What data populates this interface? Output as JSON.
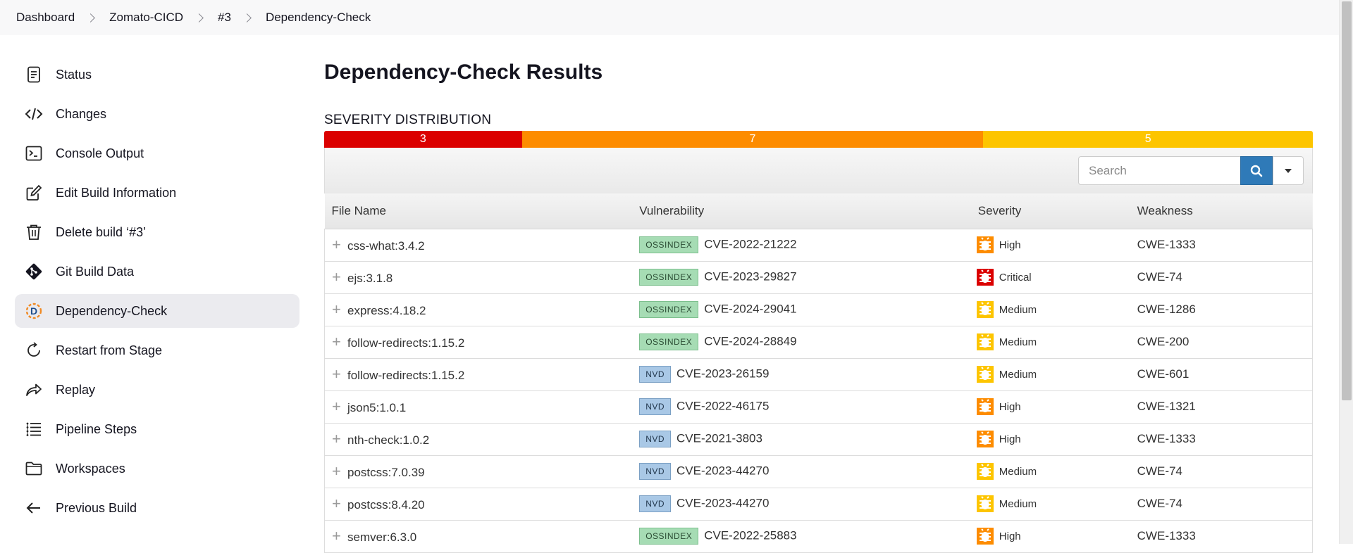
{
  "breadcrumb": [
    "Dashboard",
    "Zomato-CICD",
    "#3",
    "Dependency-Check"
  ],
  "sidebar": {
    "items": [
      {
        "label": "Status",
        "icon": "status-icon"
      },
      {
        "label": "Changes",
        "icon": "code-icon"
      },
      {
        "label": "Console Output",
        "icon": "terminal-icon"
      },
      {
        "label": "Edit Build Information",
        "icon": "edit-icon"
      },
      {
        "label": "Delete build ‘#3’",
        "icon": "trash-icon"
      },
      {
        "label": "Git Build Data",
        "icon": "git-icon"
      },
      {
        "label": "Dependency-Check",
        "icon": "dependency-check-icon",
        "active": true
      },
      {
        "label": "Restart from Stage",
        "icon": "restart-icon"
      },
      {
        "label": "Replay",
        "icon": "replay-icon"
      },
      {
        "label": "Pipeline Steps",
        "icon": "pipeline-steps-icon"
      },
      {
        "label": "Workspaces",
        "icon": "folder-icon"
      },
      {
        "label": "Previous Build",
        "icon": "arrow-left-icon"
      }
    ]
  },
  "main": {
    "title": "Dependency-Check Results",
    "severity_title": "SEVERITY DISTRIBUTION",
    "distribution": [
      {
        "count": "3",
        "color": "#db0000"
      },
      {
        "count": "7",
        "color": "#fd8c00"
      },
      {
        "count": "5",
        "color": "#fdc500"
      }
    ],
    "search": {
      "placeholder": "Search"
    },
    "columns": [
      "File Name",
      "Vulnerability",
      "Severity",
      "Weakness"
    ],
    "rows": [
      {
        "file": "css-what:3.4.2",
        "source": "OSSINDEX",
        "cve": "CVE-2022-21222",
        "severity": "High",
        "weakness": "CWE-1333"
      },
      {
        "file": "ejs:3.1.8",
        "source": "OSSINDEX",
        "cve": "CVE-2023-29827",
        "severity": "Critical",
        "weakness": "CWE-74"
      },
      {
        "file": "express:4.18.2",
        "source": "OSSINDEX",
        "cve": "CVE-2024-29041",
        "severity": "Medium",
        "weakness": "CWE-1286"
      },
      {
        "file": "follow-redirects:1.15.2",
        "source": "OSSINDEX",
        "cve": "CVE-2024-28849",
        "severity": "Medium",
        "weakness": "CWE-200"
      },
      {
        "file": "follow-redirects:1.15.2",
        "source": "NVD",
        "cve": "CVE-2023-26159",
        "severity": "Medium",
        "weakness": "CWE-601"
      },
      {
        "file": "json5:1.0.1",
        "source": "NVD",
        "cve": "CVE-2022-46175",
        "severity": "High",
        "weakness": "CWE-1321"
      },
      {
        "file": "nth-check:1.0.2",
        "source": "NVD",
        "cve": "CVE-2021-3803",
        "severity": "High",
        "weakness": "CWE-1333"
      },
      {
        "file": "postcss:7.0.39",
        "source": "NVD",
        "cve": "CVE-2023-44270",
        "severity": "Medium",
        "weakness": "CWE-74"
      },
      {
        "file": "postcss:8.4.20",
        "source": "NVD",
        "cve": "CVE-2023-44270",
        "severity": "Medium",
        "weakness": "CWE-74"
      },
      {
        "file": "semver:6.3.0",
        "source": "OSSINDEX",
        "cve": "CVE-2022-25883",
        "severity": "High",
        "weakness": "CWE-1333"
      }
    ],
    "severity_colors": {
      "Critical": "#db0000",
      "High": "#fd8c00",
      "Medium": "#fdc500"
    }
  }
}
